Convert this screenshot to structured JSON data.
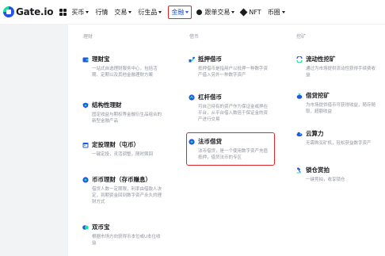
{
  "header": {
    "logo_text": "Gate.io",
    "nav": [
      {
        "label": "买币",
        "caret": true
      },
      {
        "label": "行情",
        "caret": false
      },
      {
        "label": "交易",
        "caret": true
      },
      {
        "label": "衍生品",
        "caret": true
      },
      {
        "label": "金融",
        "caret": true,
        "active": true
      },
      {
        "label": "跟单交易",
        "caret": true
      },
      {
        "label": "NFT",
        "caret": false
      },
      {
        "label": "币圈",
        "caret": true
      }
    ]
  },
  "menu": {
    "col1_title": "理财",
    "col2_title": "借币",
    "col3_title": "挖矿",
    "col1": [
      {
        "title": "理财宝",
        "desc": "一站式自选理财服务中心，包括活期、定期以及其他金融理财方案"
      },
      {
        "title": "结构性理财",
        "desc": "固定收益与期权等金融衍生品组合的新型金融产品"
      },
      {
        "title": "定投理财（屯币）",
        "desc": "一键定投，灵活调整，随时赎回"
      },
      {
        "title": "币币理财（存币赚息）",
        "desc": "借贷人数一定期限，利率由借款人决定，到期资金回到数字资产永久的理财方式"
      },
      {
        "title": "双币宝",
        "desc": "根据市场方向获得币本位或U本位收益"
      }
    ],
    "col2": [
      {
        "title": "抵押借币",
        "desc": "抵押借币是指用户以抵押一种数字资产借入另外一种数字资产"
      },
      {
        "title": "杠杆借币",
        "desc": "可自己持有的资产作为保证金或押在平台，从平台借入数倍于保证金的资产进行交易"
      },
      {
        "title": "法币借贷",
        "desc": "法币借贷，是一个使用数字资产充值抵押，借贷法币的专区"
      }
    ],
    "col3": [
      {
        "title": "流动性挖矿",
        "desc": "通过为市场提供流动性获得手续费收益"
      },
      {
        "title": "借贷挖矿",
        "desc": "为市场提供借币可获得收益，随存随取，超额收益"
      },
      {
        "title": "云算力",
        "desc": "无需购买矿机，轻松获益数字资产"
      },
      {
        "title": "锁仓赏拍",
        "desc": "一键竞拍，收享锁仓"
      }
    ]
  },
  "colors": {
    "accent": "#2354e6",
    "highlight": "#e0262a",
    "mint": "#17e3a0"
  }
}
